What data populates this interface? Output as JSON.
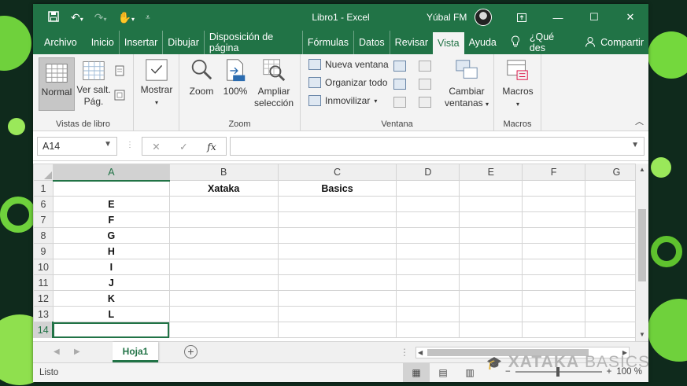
{
  "window": {
    "title": "Libro1  -  Excel",
    "user_name": "Yúbal FM",
    "controls": [
      "ribbon-display-icon",
      "minimize-icon",
      "maximize-icon",
      "close-icon"
    ]
  },
  "qat": [
    "save-icon",
    "undo-icon",
    "redo-icon",
    "touch-mode-icon",
    "customize-qat-icon"
  ],
  "tabs": [
    {
      "label": "Archivo"
    },
    {
      "label": "Inicio"
    },
    {
      "label": "Insertar"
    },
    {
      "label": "Dibujar"
    },
    {
      "label": "Disposición de página"
    },
    {
      "label": "Fórmulas"
    },
    {
      "label": "Datos"
    },
    {
      "label": "Revisar"
    },
    {
      "label": "Vista",
      "active": true
    },
    {
      "label": "Ayuda"
    },
    {
      "label": "¿Qué des"
    },
    {
      "label": "Compartir"
    }
  ],
  "ribbon": {
    "groups": {
      "vistas": {
        "label": "Vistas de libro",
        "normal": "Normal",
        "ver_salt": "Ver salt.",
        "pag": "Pág."
      },
      "mostrar": {
        "label": "Mostrar"
      },
      "zoom": {
        "label": "Zoom",
        "zoom_btn": "Zoom",
        "hundred": "100%",
        "ampliar": "Ampliar",
        "seleccion": "selección"
      },
      "ventana": {
        "label": "Ventana",
        "nueva": "Nueva ventana",
        "organizar": "Organizar todo",
        "inmovilizar": "Inmovilizar",
        "cambiar": "Cambiar",
        "ventanas": "ventanas"
      },
      "macros": {
        "label": "Macros",
        "macros_btn": "Macros"
      }
    }
  },
  "formula_bar": {
    "name_box": "A14",
    "fx": "fx",
    "formula": ""
  },
  "sheet": {
    "columns": [
      "A",
      "B",
      "C",
      "D",
      "E",
      "F",
      "G"
    ],
    "rows": [
      {
        "num": "1",
        "cells": [
          "",
          "Xataka",
          "Basics",
          "",
          "",
          "",
          ""
        ]
      },
      {
        "num": "6",
        "cells": [
          "E",
          "",
          "",
          "",
          "",
          "",
          ""
        ]
      },
      {
        "num": "7",
        "cells": [
          "F",
          "",
          "",
          "",
          "",
          "",
          ""
        ]
      },
      {
        "num": "8",
        "cells": [
          "G",
          "",
          "",
          "",
          "",
          "",
          ""
        ]
      },
      {
        "num": "9",
        "cells": [
          "H",
          "",
          "",
          "",
          "",
          "",
          ""
        ]
      },
      {
        "num": "10",
        "cells": [
          "I",
          "",
          "",
          "",
          "",
          "",
          ""
        ]
      },
      {
        "num": "11",
        "cells": [
          "J",
          "",
          "",
          "",
          "",
          "",
          ""
        ]
      },
      {
        "num": "12",
        "cells": [
          "K",
          "",
          "",
          "",
          "",
          "",
          ""
        ]
      },
      {
        "num": "13",
        "cells": [
          "L",
          "",
          "",
          "",
          "",
          "",
          ""
        ]
      },
      {
        "num": "14",
        "cells": [
          "",
          "",
          "",
          "",
          "",
          "",
          ""
        ],
        "active": true
      }
    ],
    "active_cell": "A14"
  },
  "sheet_tabs": {
    "active": "Hoja1"
  },
  "status": {
    "left": "Listo",
    "zoom": "100 %",
    "minus": "−",
    "plus": "+"
  },
  "watermark": {
    "brand": "XATAKA",
    "suffix": "BASICS"
  },
  "colors": {
    "excel_green": "#217346",
    "ribbon_bg": "#f3f3f3",
    "bg_green": "#6fd13c"
  }
}
